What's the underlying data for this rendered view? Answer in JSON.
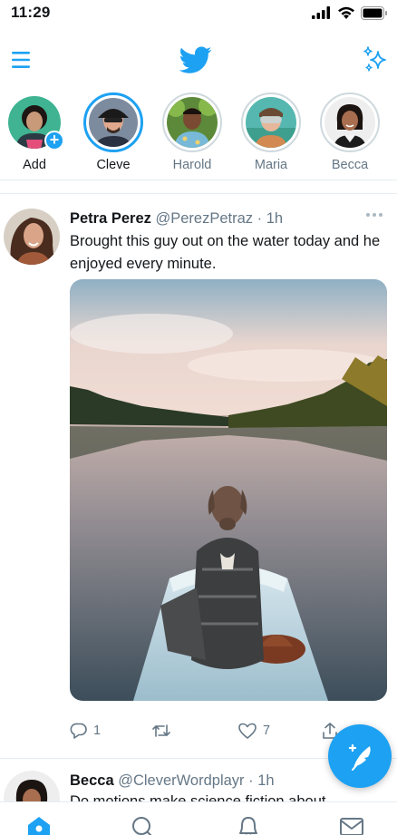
{
  "status_bar": {
    "time": "11:29"
  },
  "header": {
    "logo": "twitter-bird-icon"
  },
  "fleets": [
    {
      "name": "Add",
      "state": "add"
    },
    {
      "name": "Cleve",
      "state": "active"
    },
    {
      "name": "Harold",
      "state": "seen"
    },
    {
      "name": "Maria",
      "state": "seen"
    },
    {
      "name": "Becca",
      "state": "seen"
    }
  ],
  "tweet": {
    "display_name": "Petra Perez",
    "handle": "@PerezPetraz",
    "separator": " · ",
    "time": "1h",
    "text": "Brought this guy out on the water today and he enjoyed every minute.",
    "actions": {
      "replies": "1",
      "retweets": "",
      "likes": "7"
    }
  },
  "tweet2": {
    "display_name": "Becca",
    "handle": "@CleverWordplayr",
    "separator": " · ",
    "time": "1h",
    "text_partial": "Do motions make science fiction about"
  },
  "colors": {
    "accent": "#1da1f2",
    "muted": "#657786",
    "border": "#e6ecf0"
  }
}
